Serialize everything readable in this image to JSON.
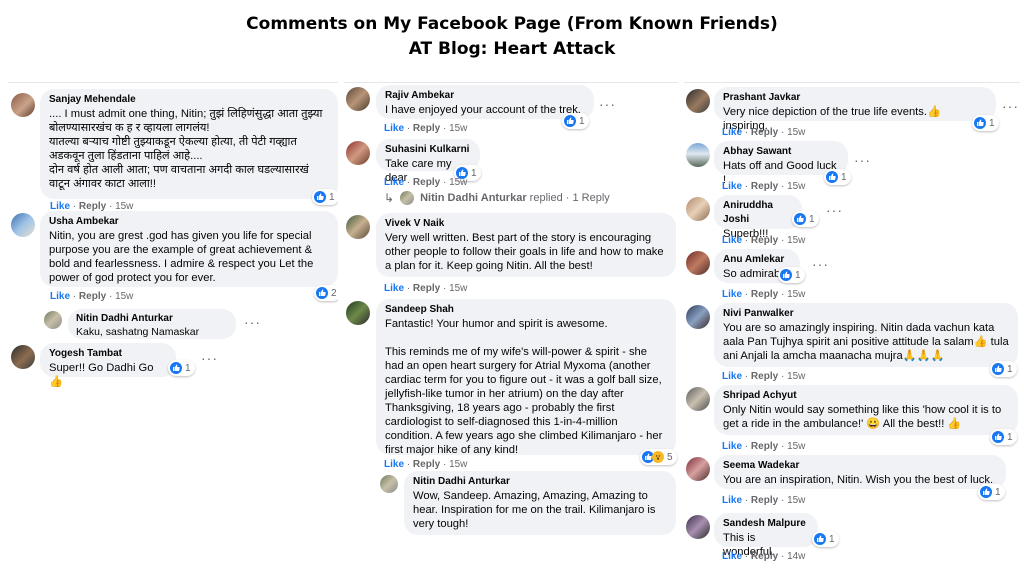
{
  "header": {
    "title_line1": "Comments on My Facebook Page (From Known Friends)",
    "title_line2": "AT Blog: Heart Attack"
  },
  "actions": {
    "like": "Like",
    "reply": "Reply",
    "sep": "·"
  },
  "colors": {
    "bubble": "#f0f2f5",
    "like_blue": "#1877f2",
    "meta_gray": "#65676b"
  },
  "col1": [
    {
      "name": "Sanjay Mehendale",
      "text": ".... I must admit one thing, Nitin; तुझं लिहिणंसुद्धा आता तुझ्या बोलण्यासारखंच क ह र व्हायला लागलंय!\nयातल्या बऱ्याच गोष्टी तुझ्याकडून ऐकल्या होत्या, ती पेटी गव्ह्यात अडकवून तुला हिंडताना पाहिलं आहे....\nदोन वर्ष होत आली आता; पण वाचताना अगदी काल घडल्यासारखं वाटून अंगावर काटा आला!!",
      "time": "15w",
      "count": "1"
    },
    {
      "name": "Usha Ambekar",
      "text": "Nitin, you are grest .god has given you life for special purpose you are the example of great achievement & bold and fearlessness. I admire & respect you Let the power of god protect you for ever.",
      "time": "15w",
      "count": "2"
    },
    {
      "name": "Nitin Dadhi Anturkar",
      "text": "Kaku, sashatng Namaskar"
    },
    {
      "name": "Yogesh Tambat",
      "text": "Super!! Go Dadhi Go 👍",
      "count": "1"
    }
  ],
  "col2": [
    {
      "name": "Rajiv Ambekar",
      "text": "I have enjoyed your account of the trek.",
      "time": "15w",
      "count": "1"
    },
    {
      "name": "Suhasini Kulkarni",
      "text": "Take care my dear",
      "time": "15w",
      "count": "1"
    },
    {
      "replied_name": "Nitin Dadhi Anturkar",
      "replied_text": "replied · 1 Reply"
    },
    {
      "name": "Vivek V Naik",
      "text": "Very well written. Best part of the story is encouraging other people to follow their goals in life and how to make a plan for it. Keep going Nitin. All the best!",
      "time": "15w"
    },
    {
      "name": "Sandeep Shah",
      "text": "Fantastic! Your humor and spirit is awesome.\n\nThis reminds me of my wife's will-power & spirit - she had an open heart surgery for Atrial Myxoma (another cardiac term for you to figure out - it was a golf ball size, jellyfish-like tumor in her atrium) on the day after Thanksgiving, 18 years ago - probably the first cardiologist to self-diagnosed this 1-in-4-million condition. A few years ago she climbed Kilimanjaro - her first major hike of any kind!",
      "time": "15w",
      "count": "5"
    },
    {
      "name": "Nitin Dadhi Anturkar",
      "text": "Wow, Sandeep. Amazing, Amazing, Amazing to hear. Inspiration for me on the trail. Kilimanjaro is very tough!"
    }
  ],
  "col3": [
    {
      "name": "Prashant Javkar",
      "text": "Very nice depiction of the true life events.👍 inspiring.",
      "time": "15w",
      "count": "1"
    },
    {
      "name": "Abhay Sawant",
      "text": "Hats off and Good luck !",
      "time": "15w",
      "count": "1"
    },
    {
      "name": "Aniruddha Joshi",
      "text": "Superb!!!",
      "time": "15w",
      "count": "1"
    },
    {
      "name": "Anu Amlekar",
      "text": "So admirable",
      "time": "15w",
      "count": "1"
    },
    {
      "name": "Nivi Panwalker",
      "text": "You are so amazingly inspiring. Nitin dada vachun kata aala Pan Tujhya spirit ani positive attitude la salam👍 tula ani Anjali la amcha maanacha mujra🙏🙏🙏",
      "time": "15w",
      "count": "1"
    },
    {
      "name": "Shripad Achyut",
      "text": "Only Nitin would say something like this 'how cool it is to get a ride in the ambulance!' 😀 All the best!! 👍",
      "time": "15w",
      "count": "1"
    },
    {
      "name": "Seema Wadekar",
      "text": "You are an inspiration, Nitin. Wish you the best of luck.",
      "time": "15w",
      "count": "1"
    },
    {
      "name": "Sandesh Malpure",
      "text": "This is wonderful.",
      "time": "14w",
      "count": "1"
    }
  ]
}
